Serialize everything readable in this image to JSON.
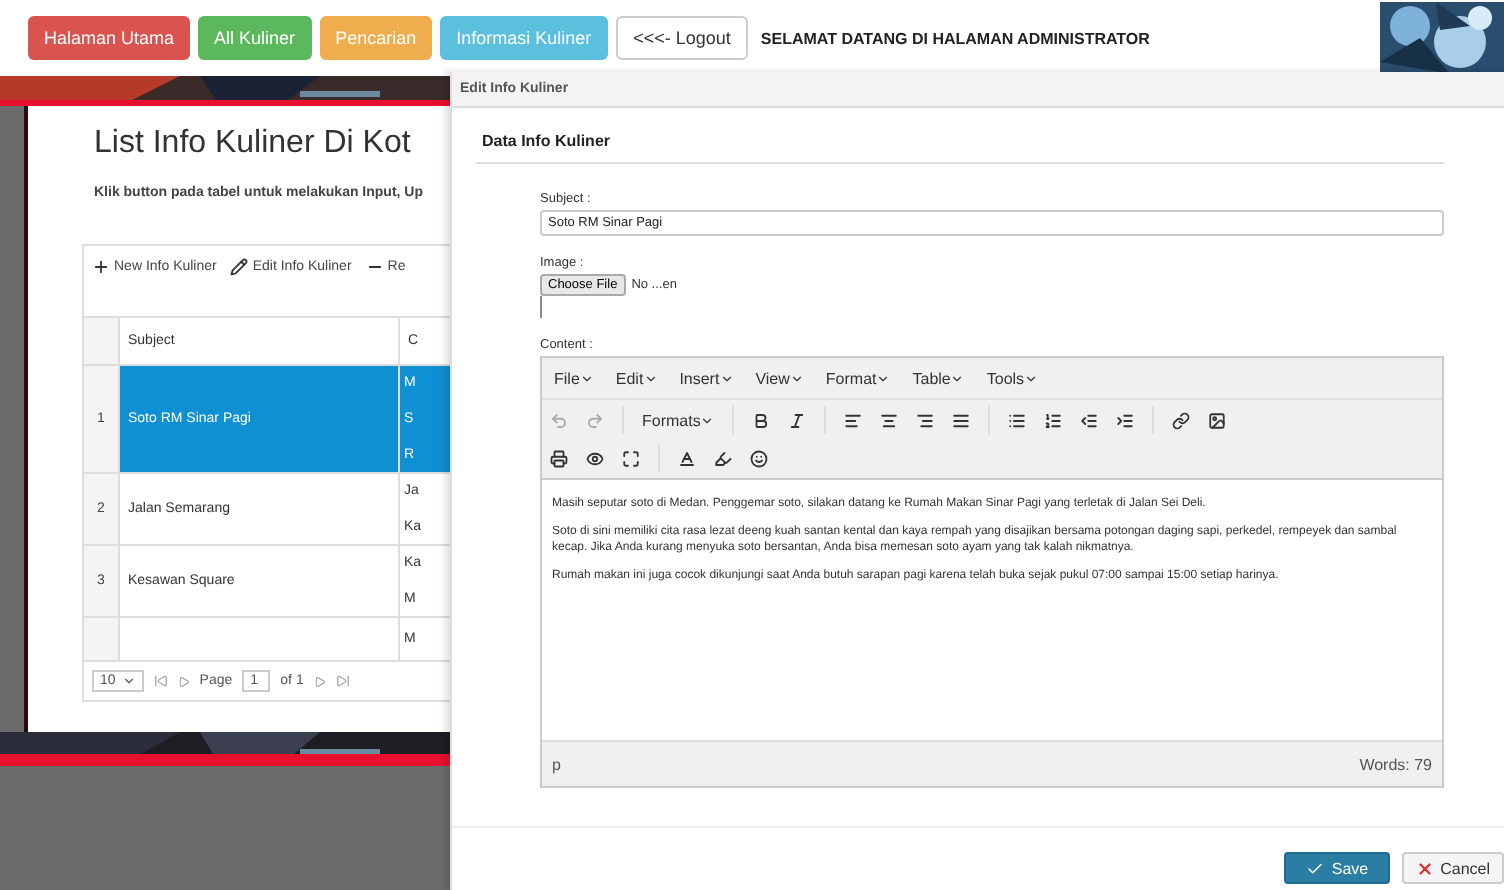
{
  "nav": {
    "buttons": [
      {
        "label": "Halaman Utama",
        "color": "#d9534f"
      },
      {
        "label": "All Kuliner",
        "color": "#5cb85c"
      },
      {
        "label": "Pencarian",
        "color": "#f0ad4e"
      },
      {
        "label": "Informasi Kuliner",
        "color": "#5bc0de"
      }
    ],
    "logout": "<<<- Logout",
    "welcome": "SELAMAT DATANG DI HALAMAN ADMINISTRATOR"
  },
  "list_page": {
    "title": "List Info Kuliner Di Kot",
    "instruction": "Klik button pada tabel untuk melakukan Input, Up",
    "toolbar": [
      {
        "kind": "add",
        "label": "New Info Kuliner"
      },
      {
        "kind": "edit",
        "label": "Edit Info Kuliner"
      },
      {
        "kind": "remove",
        "label": "Re"
      }
    ],
    "table": {
      "columns": [
        "Subject",
        "C"
      ],
      "rows": [
        {
          "number": "1",
          "subject": "Soto RM Sinar Pagi",
          "column_2": [
            "M",
            "S",
            "R"
          ],
          "selected": true
        },
        {
          "number": "2",
          "subject": "Jalan Semarang",
          "column_2": [
            "Ja",
            "Ka"
          ],
          "selected": false
        },
        {
          "number": "3",
          "subject": "Kesawan Square",
          "column_2": [
            "Ka",
            "M"
          ],
          "selected": false
        },
        {
          "number": "",
          "subject": "",
          "column_2": [
            "M"
          ],
          "selected": false
        }
      ]
    },
    "pager": {
      "page_size": "10",
      "page_label": "Page",
      "page": "1",
      "of": "of 1"
    }
  },
  "dialog": {
    "title": "Edit Info Kuliner",
    "heading": "Data Info Kuliner",
    "subject_label": "Subject :",
    "subject_value": "Soto RM Sinar Pagi",
    "image_label": "Image :",
    "choose_file": "Choose File",
    "file_status": "No ...en",
    "content_label": "Content :",
    "menus": [
      "File",
      "Edit",
      "Insert",
      "View",
      "Format",
      "Table",
      "Tools"
    ],
    "formats": "Formats",
    "paragraphs": [
      "Masih seputar soto di Medan. Penggemar soto, silakan datang ke Rumah Makan Sinar Pagi yang terletak di Jalan Sei Deli.",
      "Soto di sini memiliki cita rasa lezat deeng kuah santan kental dan kaya rempah yang disajikan bersama potongan daging sapi, perkedel, rempeyek dan sambal kecap. Jika Anda kurang menyuka soto bersantan, Anda bisa memesan soto ayam yang tak kalah nikmatnya.",
      "Rumah makan ini juga cocok dikunjungi saat Anda butuh sarapan pagi karena telah buka sejak pukul 07:00 sampai 15:00 setiap harinya."
    ],
    "path": "p",
    "word_count": "Words: 79",
    "save": "Save",
    "cancel": "Cancel"
  }
}
